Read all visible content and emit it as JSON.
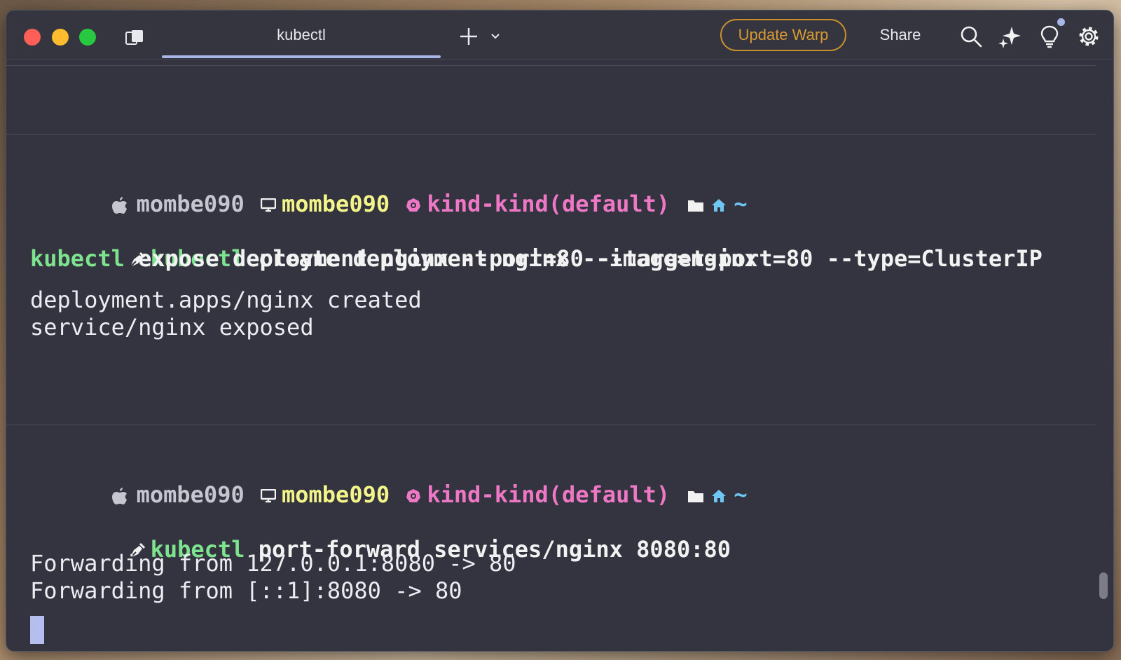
{
  "titlebar": {
    "tab_title": "kubectl",
    "update_label": "Update Warp",
    "share_label": "Share"
  },
  "blocks": [
    {
      "prompt": {
        "user": "mombe090",
        "host": "mombe090",
        "context": "kind-kind(default)",
        "dir": "~"
      },
      "command_lines": [
        {
          "cmd": "kubectl",
          "args": " create deployment nginx --image=nginx"
        },
        {
          "cmd": "kubectl",
          "args": " expose deployment nginx --port=80 --target-port=80 --type=ClusterIP"
        }
      ],
      "output": [
        "deployment.apps/nginx created",
        "service/nginx exposed"
      ]
    },
    {
      "prompt": {
        "user": "mombe090",
        "host": "mombe090",
        "context": "kind-kind(default)",
        "dir": "~"
      },
      "command_lines": [
        {
          "cmd": "kubectl",
          "args": " port-forward services/nginx 8080:80"
        }
      ],
      "output": [
        "Forwarding from 127.0.0.1:8080 -> 80",
        "Forwarding from [::1]:8080 -> 80"
      ]
    }
  ],
  "colors": {
    "background": "#33343f",
    "accent": "#a9b6e8",
    "update_button": "#c8902c",
    "command": "#7ee38e",
    "host": "#f3f58a",
    "context": "#ee78c6"
  }
}
